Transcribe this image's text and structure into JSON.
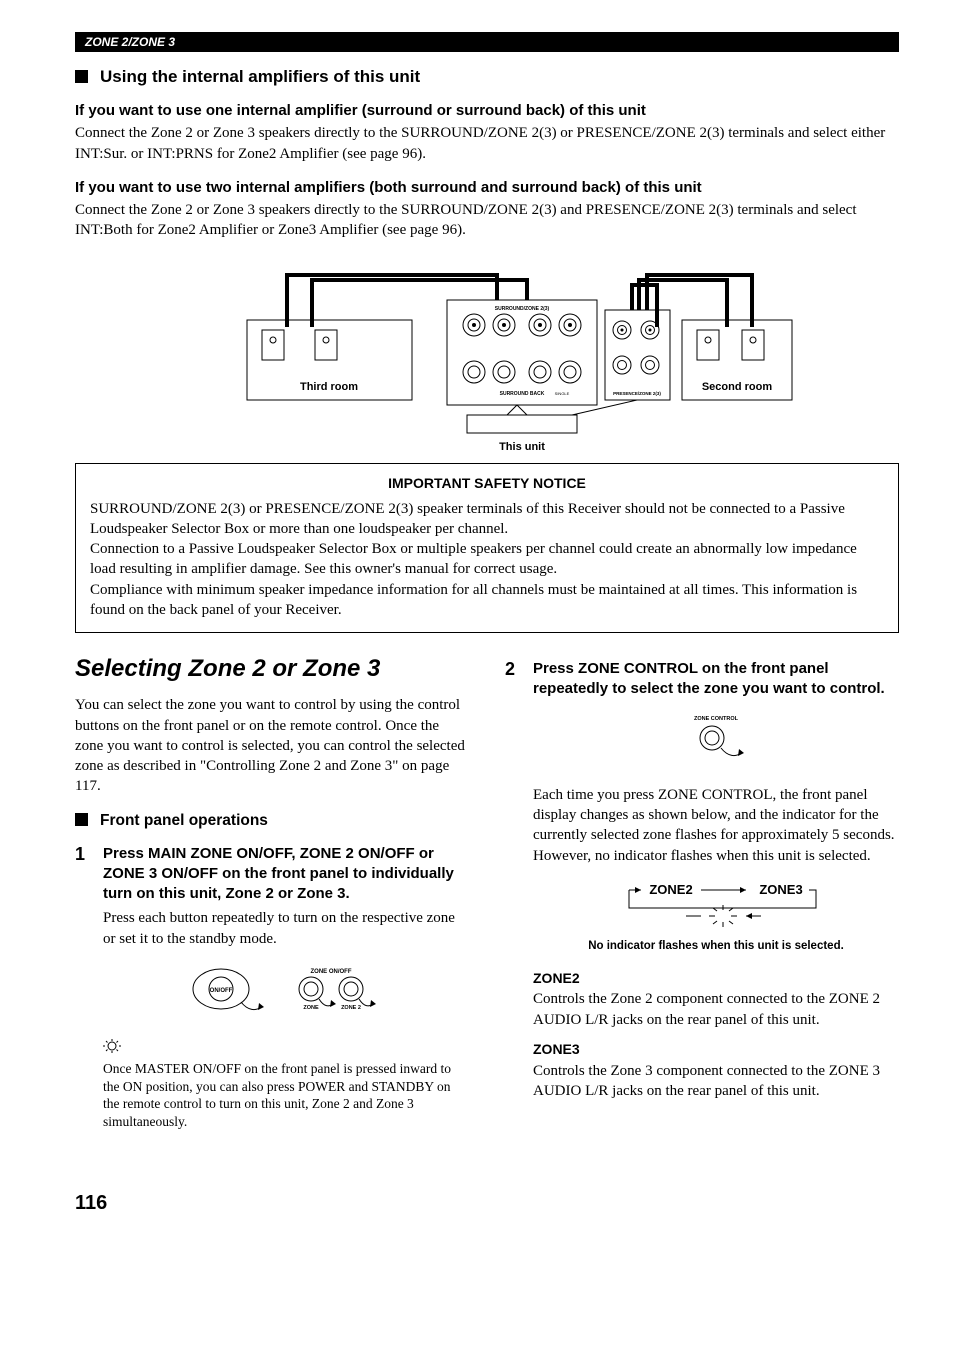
{
  "header_bar": "ZONE 2/ZONE 3",
  "h_using": "Using the internal amplifiers of this unit",
  "one_amp_title": "If you want to use one internal amplifier (surround or surround back) of this unit",
  "one_amp_body": "Connect the Zone 2 or Zone 3 speakers directly to the SURROUND/ZONE 2(3) or PRESENCE/ZONE 2(3) terminals and select either INT:Sur. or INT:PRNS for Zone2 Amplifier (see page 96).",
  "two_amp_title": "If you want to use two internal amplifiers (both surround and surround back) of this unit",
  "two_amp_body": "Connect the Zone 2 or Zone 3 speakers directly to the SURROUND/ZONE 2(3) and PRESENCE/ZONE 2(3) terminals and select INT:Both for Zone2 Amplifier or Zone3 Amplifier (see page 96).",
  "diagram": {
    "third_room": "Third room",
    "second_room": "Second room",
    "this_unit": "This unit",
    "surround_zone": "SURROUND/ZONE 2(3)",
    "surround_back": "SURROUND BACK",
    "presence_zone": "PRESENCE/ZONE 2(3)",
    "single": "SINGLE"
  },
  "notice": {
    "title": "IMPORTANT SAFETY NOTICE",
    "p1": "SURROUND/ZONE 2(3) or PRESENCE/ZONE 2(3) speaker terminals of this Receiver should not be connected to a Passive Loudspeaker Selector Box or more than one loudspeaker per channel.",
    "p2": "Connection to a Passive Loudspeaker Selector Box or multiple speakers per channel could create an abnormally low impedance load resulting in amplifier damage. See this owner's manual for correct usage.",
    "p3": "Compliance with minimum speaker impedance information for all channels must be maintained at all times. This information is found on the back panel of your Receiver."
  },
  "section_title": "Selecting Zone 2 or Zone 3",
  "left_intro": "You can select the zone you want to control by using the control buttons on the front panel or on the remote control. Once the zone you want to control is selected, you can control the selected zone as described in \"Controlling Zone 2 and Zone 3\" on page 117.",
  "h_front": "Front panel operations",
  "step1": {
    "num": "1",
    "head": "Press MAIN ZONE ON/OFF, ZONE 2 ON/OFF or ZONE 3 ON/OFF on the front panel to individually turn on this unit, Zone 2 or Zone 3.",
    "body": "Press each button repeatedly to turn on the respective zone or set it to the standby mode.",
    "labels": {
      "onoff": "ON/OFF",
      "zone_onoff": "ZONE ON/OFF",
      "zone": "ZONE",
      "zone2": "ZONE 2"
    }
  },
  "tip": "Once MASTER ON/OFF on the front panel is pressed inward to the ON position, you can also press POWER and STANDBY on the remote control to turn on this unit, Zone 2 and Zone 3 simultaneously.",
  "step2": {
    "num": "2",
    "head": "Press ZONE CONTROL on the front panel repeatedly to select the zone you want to control.",
    "label": "ZONE CONTROL",
    "body": "Each time you press ZONE CONTROL, the front panel display changes as shown below, and the indicator for the currently selected zone flashes for approximately 5 seconds. However, no indicator flashes when this unit is selected.",
    "flow_z2": "ZONE2",
    "flow_z3": "ZONE3",
    "flow_caption": "No indicator flashes when this unit is selected."
  },
  "zone2": {
    "title": "ZONE2",
    "body": "Controls the Zone 2 component connected to the ZONE 2 AUDIO L/R jacks on the rear panel of this unit."
  },
  "zone3": {
    "title": "ZONE3",
    "body": "Controls the Zone 3 component connected to the ZONE 3 AUDIO L/R jacks on the rear panel of this unit."
  },
  "page_number": "116"
}
